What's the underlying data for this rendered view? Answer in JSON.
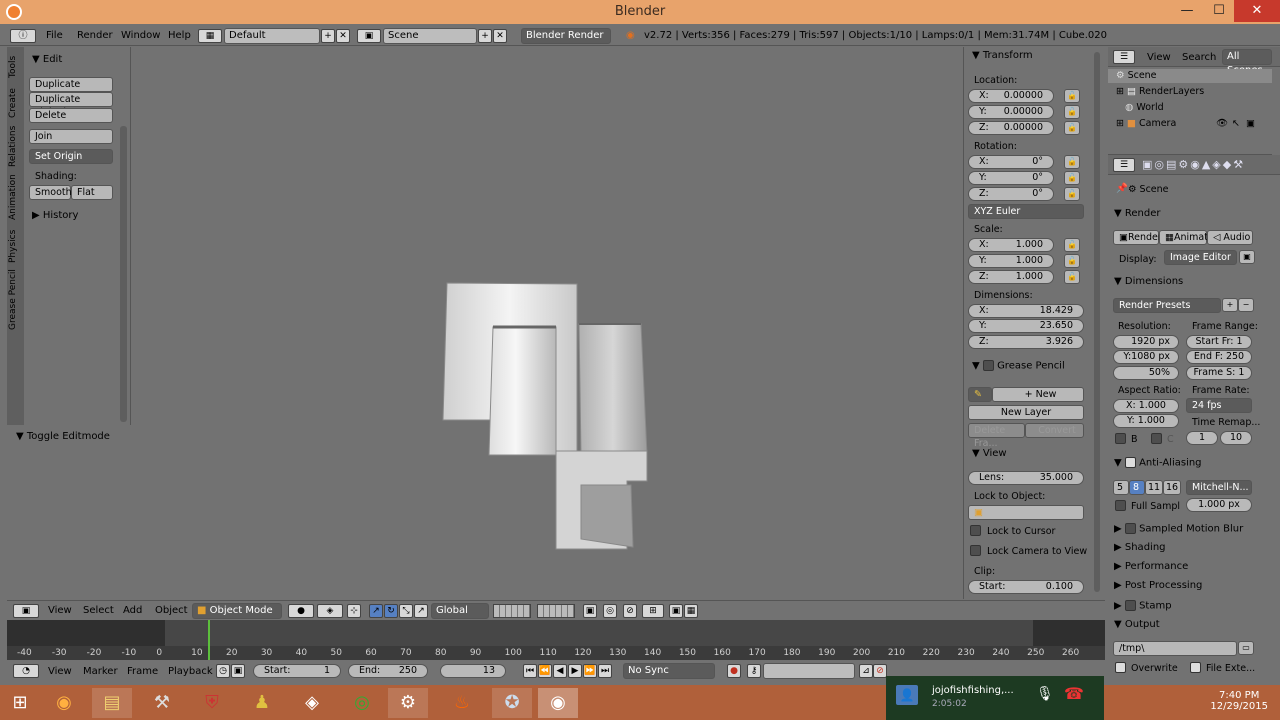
{
  "window": {
    "title": "Blender",
    "minimize": "—",
    "maximize": "☐",
    "close": "✕"
  },
  "infobar": {
    "menus": [
      "File",
      "Render",
      "Window",
      "Help"
    ],
    "layout": "Default",
    "scene": "Scene",
    "engine": "Blender Render",
    "stats": "v2.72 | Verts:356 | Faces:279 | Tris:597 | Objects:1/10 | Lamps:0/1 | Mem:31.74M | Cube.020"
  },
  "toolshelf": {
    "tabs": [
      "Tools",
      "Create",
      "Relations",
      "Animation",
      "Physics",
      "Grease Pencil"
    ],
    "edit_header": "Edit",
    "buttons": [
      "Duplicate",
      "Duplicate Linked",
      "Delete",
      "Join"
    ],
    "set_origin": "Set Origin",
    "shading_label": "Shading:",
    "smooth": "Smooth",
    "flat": "Flat",
    "history": "History",
    "toggle": "Toggle Editmode"
  },
  "npanel": {
    "transform": "Transform",
    "location": "Location:",
    "loc": [
      {
        "l": "X:",
        "v": "0.00000"
      },
      {
        "l": "Y:",
        "v": "0.00000"
      },
      {
        "l": "Z:",
        "v": "0.00000"
      }
    ],
    "rotation": "Rotation:",
    "rot": [
      {
        "l": "X:",
        "v": "0°"
      },
      {
        "l": "Y:",
        "v": "0°"
      },
      {
        "l": "Z:",
        "v": "0°"
      }
    ],
    "euler": "XYZ Euler",
    "scale": "Scale:",
    "scl": [
      {
        "l": "X:",
        "v": "1.000"
      },
      {
        "l": "Y:",
        "v": "1.000"
      },
      {
        "l": "Z:",
        "v": "1.000"
      }
    ],
    "dimensions": "Dimensions:",
    "dim": [
      {
        "l": "X:",
        "v": "18.429"
      },
      {
        "l": "Y:",
        "v": "23.650"
      },
      {
        "l": "Z:",
        "v": "3.926"
      }
    ],
    "grease": "Grease Pencil",
    "new": "New",
    "new_layer": "New Layer",
    "delete_frame": "Delete Fra...",
    "convert": "Convert",
    "view": "View",
    "lens_label": "Lens:",
    "lens": "35.000",
    "lock_obj": "Lock to Object:",
    "lock_cursor": "Lock to Cursor",
    "lock_camera": "Lock Camera to View",
    "clip": "Clip:",
    "clip_start_label": "Start:",
    "clip_start": "0.100"
  },
  "outliner": {
    "view": "View",
    "search": "Search",
    "all_scenes": "All Scenes",
    "items": [
      "Scene",
      "RenderLayers",
      "World",
      "Camera"
    ]
  },
  "props": {
    "scene": "Scene",
    "render": "Render",
    "render_btn": "Render",
    "anim_btn": "Animati",
    "audio_btn": "Audio",
    "display_label": "Display:",
    "display": "Image Editor",
    "dimensions": "Dimensions",
    "presets": "Render Presets",
    "resolution": "Resolution:",
    "frame_range": "Frame Range:",
    "res_x": "1920 px",
    "res_y": "Y:1080 px",
    "res_pct": "50%",
    "start_fr": "Start Fr: 1",
    "end_fr": "End F: 250",
    "frame_step": "Frame S: 1",
    "aspect": "Aspect Ratio:",
    "frame_rate": "Frame Rate:",
    "asp_x": "X:  1.000",
    "asp_y": "Y:  1.000",
    "fps": "24 fps",
    "time_remap": "Time Remap...",
    "remap_old": "1",
    "remap_new": "10",
    "b": "B",
    "c": "C",
    "aa": "Anti-Aliasing",
    "aa_levels": [
      "5",
      "8",
      "11",
      "16"
    ],
    "filter": "Mitchell-N...",
    "full_sample": "Full Sampl",
    "filter_size": "1.000 px",
    "motion_blur": "Sampled Motion Blur",
    "shading": "Shading",
    "performance": "Performance",
    "post": "Post Processing",
    "stamp": "Stamp",
    "output": "Output",
    "path": "/tmp\\",
    "overwrite": "Overwrite",
    "file_ext": "File Exte..."
  },
  "vpheader": {
    "view": "View",
    "select": "Select",
    "add": "Add",
    "object": "Object",
    "mode": "Object Mode",
    "orientation": "Global"
  },
  "timeline": {
    "ticks": [
      "-40",
      "-30",
      "-20",
      "-10",
      "0",
      "10",
      "20",
      "30",
      "40",
      "50",
      "60",
      "70",
      "80",
      "90",
      "100",
      "110",
      "120",
      "130",
      "140",
      "150",
      "160",
      "170",
      "180",
      "190",
      "200",
      "210",
      "220",
      "230",
      "240",
      "250",
      "260"
    ],
    "view": "View",
    "marker": "Marker",
    "frame": "Frame",
    "playback": "Playback",
    "start_label": "Start:",
    "start": "1",
    "end_label": "End:",
    "end": "250",
    "current": "13",
    "sync": "No Sync"
  },
  "call": {
    "name": "jojofishfishing,...",
    "time": "2:05:02"
  },
  "clock": {
    "time": "7:40 PM",
    "date": "12/29/2015"
  }
}
